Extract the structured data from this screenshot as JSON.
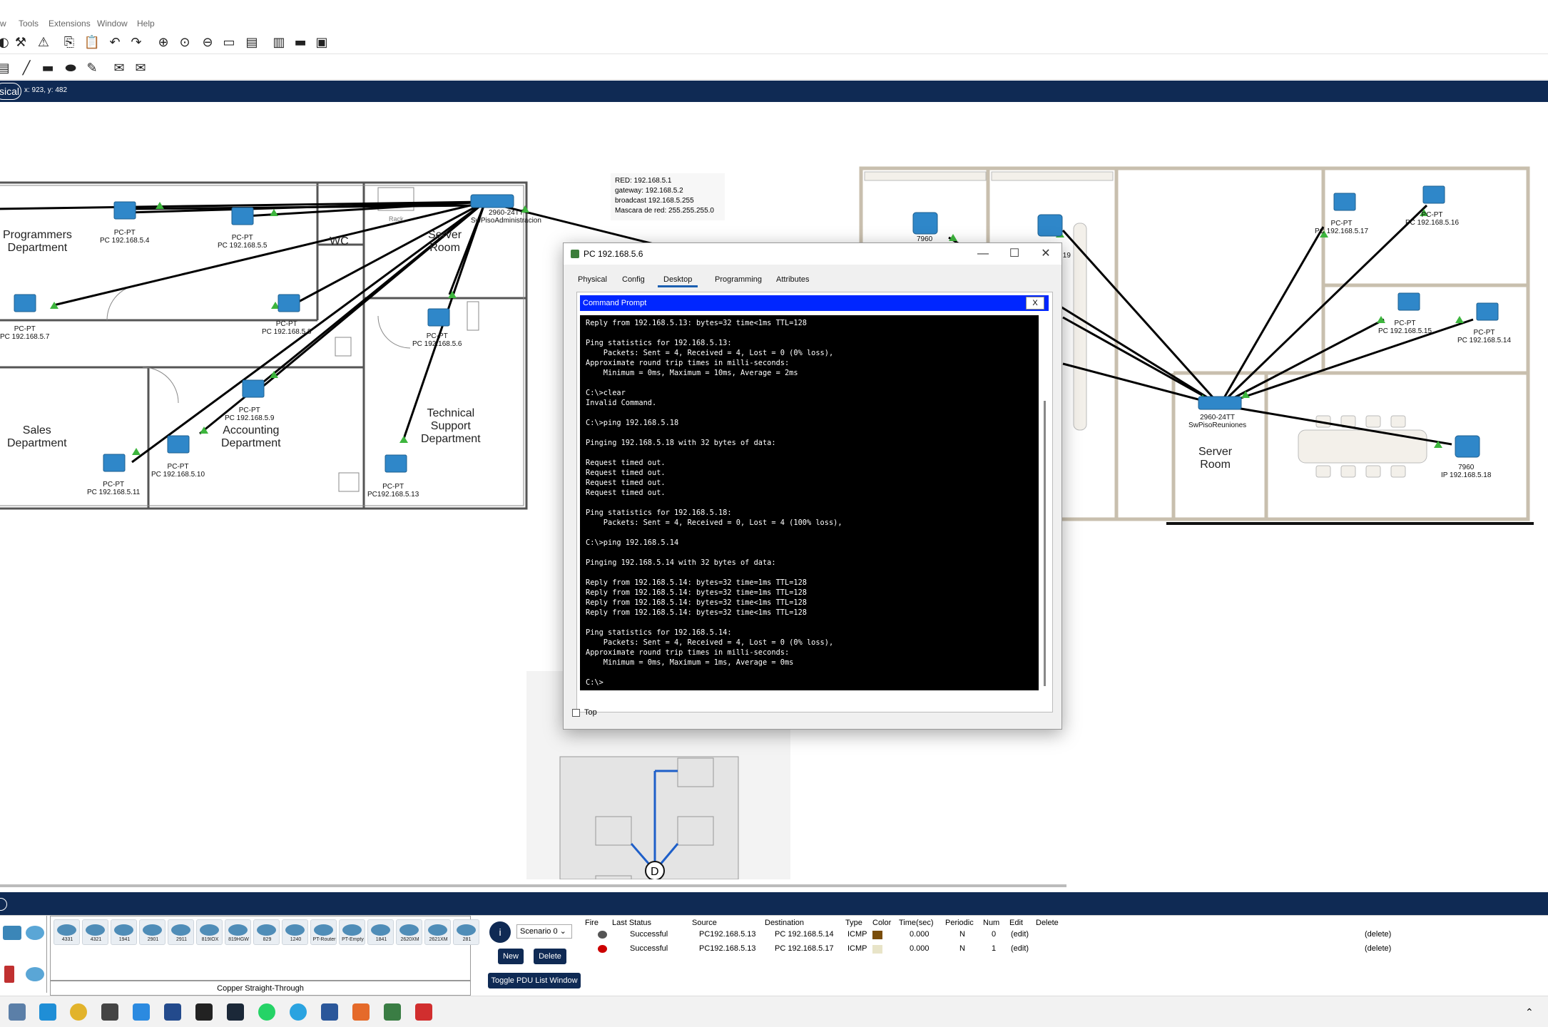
{
  "menu": [
    "w",
    "Tools",
    "Extensions",
    "Window",
    "Help"
  ],
  "workspace": {
    "mode_label": "sical",
    "coords": "x: 923, y: 482"
  },
  "info_note": [
    "RED: 192.168.5.1",
    "gateway: 192.168.5.2",
    "broadcast 192.168.5.255",
    "Mascara de red: 255.255.255.0"
  ],
  "left_floor": {
    "departments": [
      "Programmers\nDepartment",
      "WC",
      "Server\nRoom",
      "Sales\nDepartment",
      "Accounting\nDepartment",
      "Technical\nSupport\nDepartment"
    ],
    "pcs": [
      {
        "type": "PC-PT",
        "ip": "PC 192.168.5.4"
      },
      {
        "type": "PC-PT",
        "ip": "PC 192.168.5.5"
      },
      {
        "type": "PC-PT",
        "ip": "PC 192.168.5.7"
      },
      {
        "type": "PC-PT",
        "ip": "PC 192.168.5.8"
      },
      {
        "type": "PC-PT",
        "ip": "PC 192.168.5.6"
      },
      {
        "type": "PC-PT",
        "ip": "PC 192.168.5.9"
      },
      {
        "type": "PC-PT",
        "ip": "PC 192.168.5.10"
      },
      {
        "type": "PC-PT",
        "ip": "PC 192.168.5.11"
      },
      {
        "type": "PC-PT",
        "ip": "PC192.168.5.13"
      }
    ],
    "switch": {
      "model": "2960-24TT",
      "name": "SwPisoAdministracion"
    },
    "rack_label": "Rack"
  },
  "right_floor": {
    "pcs": [
      {
        "type": "PC-PT",
        "ip": "PC 192.168.5.17"
      },
      {
        "type": "PC-PT",
        "ip": "PC 192.168.5.16"
      },
      {
        "type": "PC-PT",
        "ip": "PC 192.168.5.15"
      },
      {
        "type": "PC-PT",
        "ip": "PC 192.168.5.14"
      }
    ],
    "phones": [
      {
        "model": "7960",
        "ip": "IP 192.168.5.18"
      },
      {
        "model": "7960",
        "ip": ""
      }
    ],
    "switch": {
      "model": "2960-24TT",
      "name": "SwPisoReuniones"
    },
    "server_room": "Server\nRoom",
    "partial_label": ".19"
  },
  "dialog": {
    "title": "PC 192.168.5.6",
    "tabs": [
      "Physical",
      "Config",
      "Desktop",
      "Programming",
      "Attributes"
    ],
    "active_tab": "Desktop",
    "cmd_title": "Command Prompt",
    "cmd_close": "X",
    "terminal": "Reply from 192.168.5.13: bytes=32 time<1ms TTL=128\n\nPing statistics for 192.168.5.13:\n    Packets: Sent = 4, Received = 4, Lost = 0 (0% loss),\nApproximate round trip times in milli-seconds:\n    Minimum = 0ms, Maximum = 10ms, Average = 2ms\n\nC:\\>clear\nInvalid Command.\n\nC:\\>ping 192.168.5.18\n\nPinging 192.168.5.18 with 32 bytes of data:\n\nRequest timed out.\nRequest timed out.\nRequest timed out.\nRequest timed out.\n\nPing statistics for 192.168.5.18:\n    Packets: Sent = 4, Received = 0, Lost = 4 (100% loss),\n\nC:\\>ping 192.168.5.14\n\nPinging 192.168.5.14 with 32 bytes of data:\n\nReply from 192.168.5.14: bytes=32 time=1ms TTL=128\nReply from 192.168.5.14: bytes=32 time=1ms TTL=128\nReply from 192.168.5.14: bytes=32 time<1ms TTL=128\nReply from 192.168.5.14: bytes=32 time<1ms TTL=128\n\nPing statistics for 192.168.5.14:\n    Packets: Sent = 4, Received = 4, Lost = 0 (0% loss),\nApproximate round trip times in milli-seconds:\n    Minimum = 0ms, Maximum = 1ms, Average = 0ms\n\nC:\\>",
    "top_checkbox": "Top"
  },
  "devices": {
    "items": [
      "4331",
      "4321",
      "1941",
      "2901",
      "2911",
      "819IOX",
      "819HGW",
      "829",
      "1240",
      "PT-Router",
      "PT-Empty",
      "1841",
      "2620XM",
      "2621XM",
      "281"
    ],
    "selected_connection": "Copper Straight-Through"
  },
  "scenario": {
    "info": "i",
    "select": "Scenario 0",
    "new": "New",
    "delete": "Delete",
    "toggle": "Toggle PDU List Window"
  },
  "pdu": {
    "headers": [
      "Fire",
      "Last Status",
      "Source",
      "Destination",
      "Type",
      "Color",
      "Time(sec)",
      "Periodic",
      "Num",
      "Edit",
      "Delete"
    ],
    "rows": [
      {
        "status": "Successful",
        "source": "PC192.168.5.13",
        "destination": "PC 192.168.5.14",
        "type": "ICMP",
        "color": "#7a4d0a",
        "time": "0.000",
        "periodic": "N",
        "num": "0",
        "edit": "(edit)",
        "delete": "(delete)"
      },
      {
        "status": "Successful",
        "source": "PC192.168.5.13",
        "destination": "PC 192.168.5.17",
        "type": "ICMP",
        "color": "#e8e4c8",
        "time": "0.000",
        "periodic": "N",
        "num": "1",
        "edit": "(edit)",
        "delete": "(delete)"
      }
    ]
  },
  "colors": {
    "accent": "#0f2a54",
    "cmd_title": "#0026ff",
    "link_dot": "#3db53d"
  }
}
